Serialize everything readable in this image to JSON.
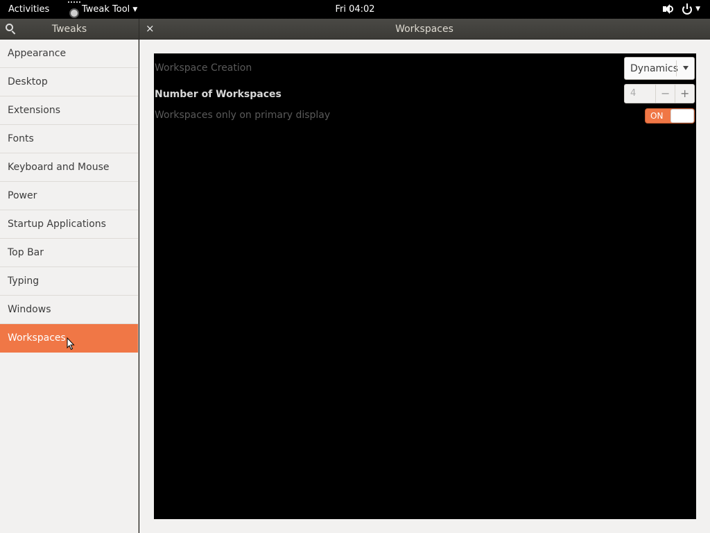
{
  "topbar": {
    "activities": "Activities",
    "app_name": "Tweak Tool",
    "clock": "Fri 04:02"
  },
  "header": {
    "sidebar_title": "Tweaks",
    "main_title": "Workspaces",
    "close_glyph": "×"
  },
  "sidebar": {
    "items": [
      {
        "label": "Appearance"
      },
      {
        "label": "Desktop"
      },
      {
        "label": "Extensions"
      },
      {
        "label": "Fonts"
      },
      {
        "label": "Keyboard and Mouse"
      },
      {
        "label": "Power"
      },
      {
        "label": "Startup Applications"
      },
      {
        "label": "Top Bar"
      },
      {
        "label": "Typing"
      },
      {
        "label": "Windows"
      },
      {
        "label": "Workspaces"
      }
    ],
    "selected": "Workspaces"
  },
  "main": {
    "workspace_creation": {
      "label": "Workspace Creation",
      "value": "Dynamics"
    },
    "number_of_workspaces": {
      "label": "Number of Workspaces",
      "value": "4",
      "minus": "−",
      "plus": "+"
    },
    "primary_display": {
      "label": "Workspaces only on primary display",
      "state": "ON"
    }
  },
  "colors": {
    "accent": "#f07746",
    "topbar": "#000000",
    "header": "#3c3b37",
    "sidebar_bg": "#f2f1f0"
  },
  "icons": {
    "search": "search-icon",
    "close": "close-icon",
    "volume": "volume-icon",
    "power": "power-icon"
  }
}
